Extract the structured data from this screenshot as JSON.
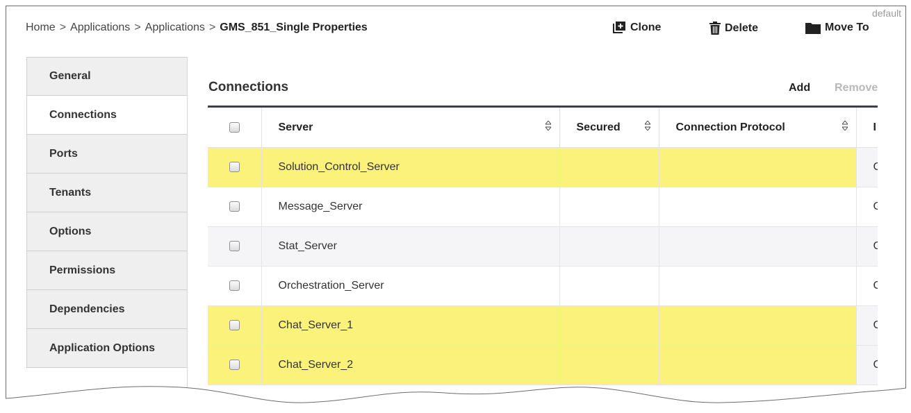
{
  "breadcrumb": {
    "items": [
      "Home",
      "Applications",
      "Applications"
    ],
    "separator": ">",
    "current": "GMS_851_Single Properties"
  },
  "corner_tag": "default",
  "toolbar": {
    "clone_label": "Clone",
    "delete_label": "Delete",
    "move_label": "Move To"
  },
  "sidebar": {
    "items": [
      {
        "label": "General"
      },
      {
        "label": "Connections",
        "active": true
      },
      {
        "label": "Ports"
      },
      {
        "label": "Tenants"
      },
      {
        "label": "Options"
      },
      {
        "label": "Permissions"
      },
      {
        "label": "Dependencies"
      },
      {
        "label": "Application Options"
      }
    ]
  },
  "section": {
    "title": "Connections",
    "add_label": "Add",
    "remove_label": "Remove"
  },
  "table": {
    "columns": [
      "Server",
      "Secured",
      "Connection Protocol",
      "I"
    ],
    "rows": [
      {
        "server": "Solution_Control_Server",
        "secured": "",
        "protocol": "",
        "extra": "C",
        "highlighted": true
      },
      {
        "server": "Message_Server",
        "secured": "",
        "protocol": "",
        "extra": "C",
        "highlighted": false
      },
      {
        "server": "Stat_Server",
        "secured": "",
        "protocol": "",
        "extra": "C",
        "highlighted": false
      },
      {
        "server": "Orchestration_Server",
        "secured": "",
        "protocol": "",
        "extra": "C",
        "highlighted": false
      },
      {
        "server": "Chat_Server_1",
        "secured": "",
        "protocol": "",
        "extra": "C",
        "highlighted": true
      },
      {
        "server": "Chat_Server_2",
        "secured": "",
        "protocol": "",
        "extra": "C",
        "highlighted": true
      }
    ]
  },
  "colors": {
    "highlight": "#fbf27c",
    "header_rule": "#3c3f4a",
    "disabled_text": "#b8b8b8"
  }
}
